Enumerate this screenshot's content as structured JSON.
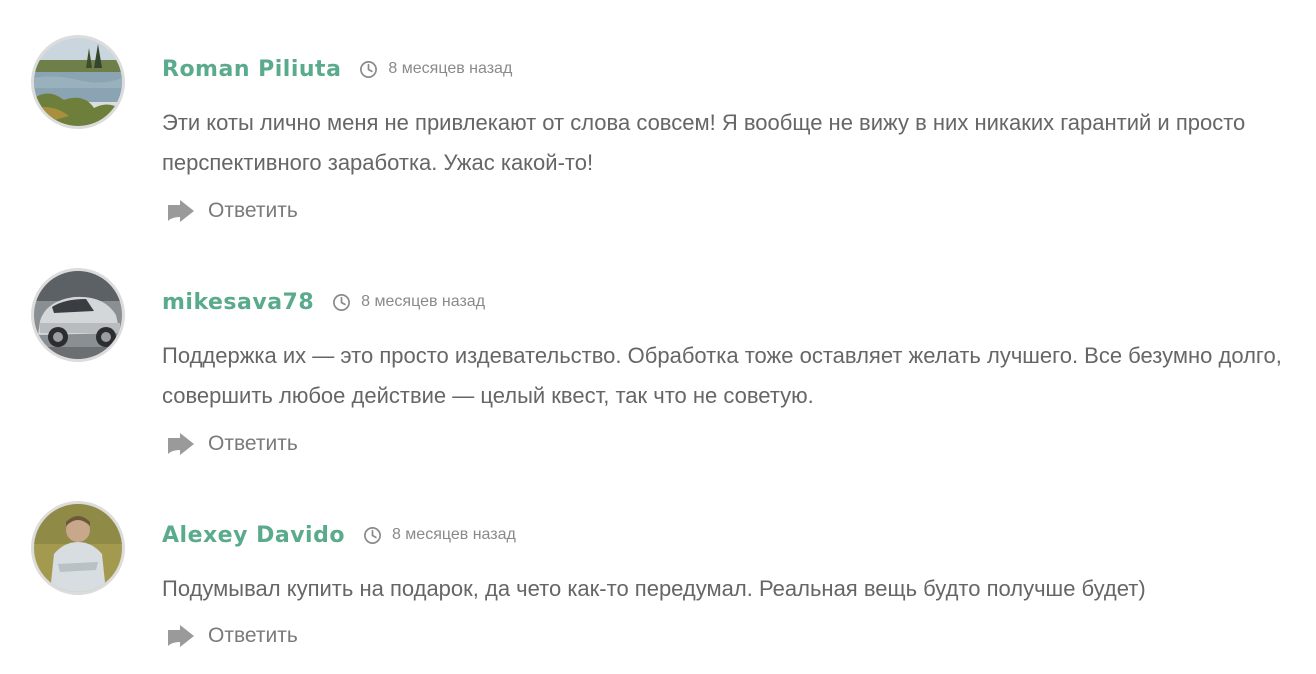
{
  "comments": [
    {
      "author": "Roman Piliuta",
      "time": "8 месяцев назад",
      "text": "Эти коты лично меня не привлекают от слова совсем! Я вообще не вижу в них никаких гарантий и просто перспективного заработка. Ужас какой-то!",
      "reply_label": "Ответить"
    },
    {
      "author": "mikesava78",
      "time": "8 месяцев назад",
      "text": "Поддержка их — это просто издевательство. Обработка тоже оставляет желать лучшего. Все безумно долго, совершить любое действие — целый квест, так что не советую.",
      "reply_label": "Ответить"
    },
    {
      "author": "Alexey Davido",
      "time": "8 месяцев назад",
      "text": "Подумывал купить на подарок, да чето как-то передумал. Реальная вещь будто получше будет)",
      "reply_label": "Ответить"
    }
  ],
  "colors": {
    "author": "#5aaa8c",
    "text": "#666666",
    "meta": "#8a8a8a",
    "avatar_border": "#dcdcdc"
  },
  "icons": {
    "time": "clock-icon",
    "reply": "reply-arrow-icon"
  }
}
